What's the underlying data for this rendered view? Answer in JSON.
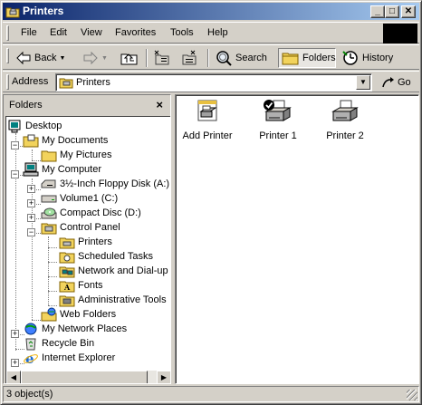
{
  "window": {
    "title": "Printers"
  },
  "menu": [
    "File",
    "Edit",
    "View",
    "Favorites",
    "Tools",
    "Help"
  ],
  "toolbar": {
    "back": "Back",
    "search": "Search",
    "folders": "Folders",
    "history": "History"
  },
  "address": {
    "label": "Address",
    "value": "Printers",
    "go": "Go"
  },
  "folders_pane": {
    "title": "Folders",
    "close": "×",
    "tree": [
      "Desktop",
      "My Documents",
      "My Pictures",
      "My Computer",
      "3½-Inch Floppy Disk (A:)",
      "Volume1 (C:)",
      "Compact Disc (D:)",
      "Control Panel",
      "Printers",
      "Scheduled Tasks",
      "Network and Dial-up C",
      "Fonts",
      "Administrative Tools",
      "Web Folders",
      "My Network Places",
      "Recycle Bin",
      "Internet Explorer"
    ]
  },
  "items": [
    {
      "label": "Add Printer",
      "icon": "add-printer-icon"
    },
    {
      "label": "Printer 1",
      "icon": "default-printer-icon"
    },
    {
      "label": "Printer 2",
      "icon": "printer-icon"
    }
  ],
  "status": {
    "text": "3 object(s)"
  }
}
